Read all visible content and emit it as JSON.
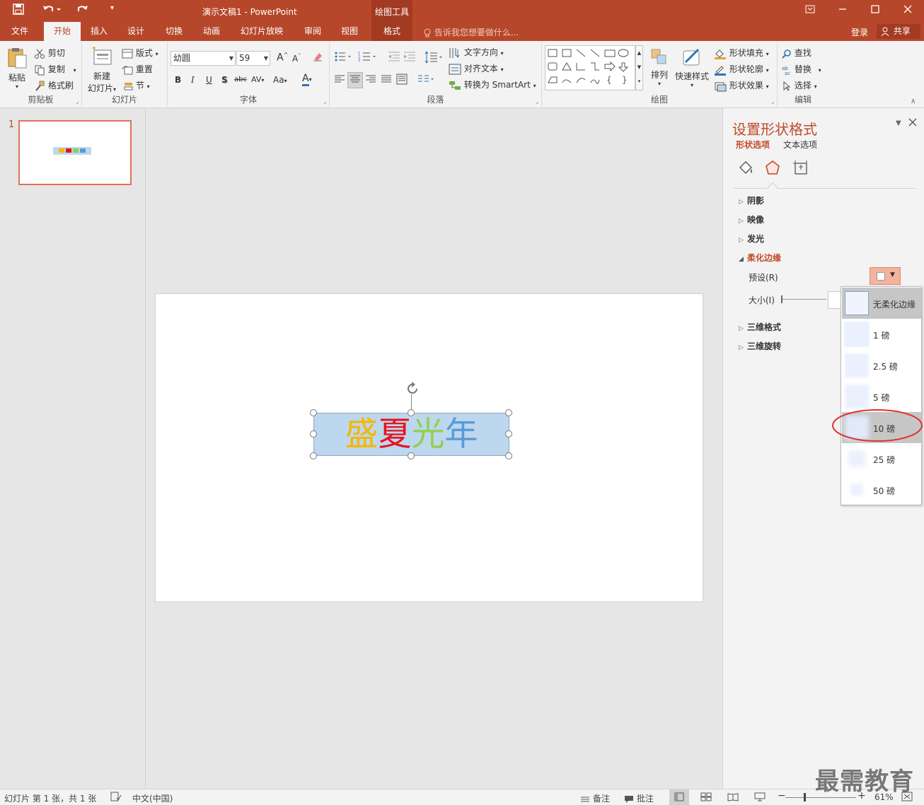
{
  "window": {
    "title": "演示文稿1 - PowerPoint",
    "context_tab_group": "绘图工具"
  },
  "tabs": [
    {
      "label": "文件"
    },
    {
      "label": "开始"
    },
    {
      "label": "插入"
    },
    {
      "label": "设计"
    },
    {
      "label": "切换"
    },
    {
      "label": "动画"
    },
    {
      "label": "幻灯片放映"
    },
    {
      "label": "审阅"
    },
    {
      "label": "视图"
    },
    {
      "label": "格式"
    }
  ],
  "tellme": "告诉我您想要做什么...",
  "account": {
    "login": "登录",
    "share": "共享"
  },
  "ribbon": {
    "clipboard": {
      "label": "剪贴板",
      "paste": "粘贴",
      "cut": "剪切",
      "copy": "复制",
      "format_painter": "格式刷"
    },
    "slides": {
      "label": "幻灯片",
      "new_slide_1": "新建",
      "new_slide_2": "幻灯片",
      "layout": "版式",
      "reset": "重置",
      "section": "节"
    },
    "font": {
      "label": "字体",
      "font_name": "幼圆",
      "font_size": "59",
      "bold": "B",
      "italic": "I",
      "underline": "U",
      "shadow": "S",
      "strike": "abc",
      "spacing": "AV",
      "case": "Aa",
      "color": "A",
      "grow": "A",
      "shrink": "A"
    },
    "paragraph": {
      "label": "段落",
      "text_direction": "文字方向",
      "align_text": "对齐文本",
      "smartart": "转换为 SmartArt"
    },
    "drawing": {
      "label": "绘图",
      "arrange": "排列",
      "quick_styles": "快速样式",
      "shape_fill": "形状填充",
      "shape_outline": "形状轮廓",
      "shape_effects": "形状效果"
    },
    "editing": {
      "label": "编辑",
      "find": "查找",
      "replace": "替换",
      "select": "选择"
    }
  },
  "thumbnails": {
    "slide_number": "1"
  },
  "slide": {
    "textbox_chars": [
      {
        "ch": "盛",
        "color": "#f5b700"
      },
      {
        "ch": "夏",
        "color": "#e8121b"
      },
      {
        "ch": "光",
        "color": "#92d050"
      },
      {
        "ch": "年",
        "color": "#5b9bd5"
      }
    ]
  },
  "format_pane": {
    "title": "设置形状格式",
    "tab_shape": "形状选项",
    "tab_text": "文本选项",
    "sections": {
      "shadow": "阴影",
      "reflection": "映像",
      "glow": "发光",
      "soft_edges": "柔化边缘",
      "format_3d": "三维格式",
      "rotation_3d": "三维旋转"
    },
    "preset_label": "预设(R)",
    "size_label": "大小(I)"
  },
  "soft_edge_gallery": {
    "items": [
      {
        "label": "无柔化边缘",
        "blur_pt": 0
      },
      {
        "label": "1 磅",
        "blur_pt": 1
      },
      {
        "label": "2.5 磅",
        "blur_pt": 2.5
      },
      {
        "label": "5 磅",
        "blur_pt": 5
      },
      {
        "label": "10 磅",
        "blur_pt": 10
      },
      {
        "label": "25 磅",
        "blur_pt": 25
      },
      {
        "label": "50 磅",
        "blur_pt": 50
      }
    ],
    "highlighted": "10 磅"
  },
  "statusbar": {
    "slide_info": "幻灯片 第 1 张，共 1 张",
    "language": "中文(中国)",
    "notes": "备注",
    "comments": "批注",
    "zoom": "61%"
  },
  "watermark": "最需教育",
  "colors": {
    "accent": "#b7472a",
    "pane_title": "#c14a2a",
    "highlight_circle": "#e03030"
  }
}
